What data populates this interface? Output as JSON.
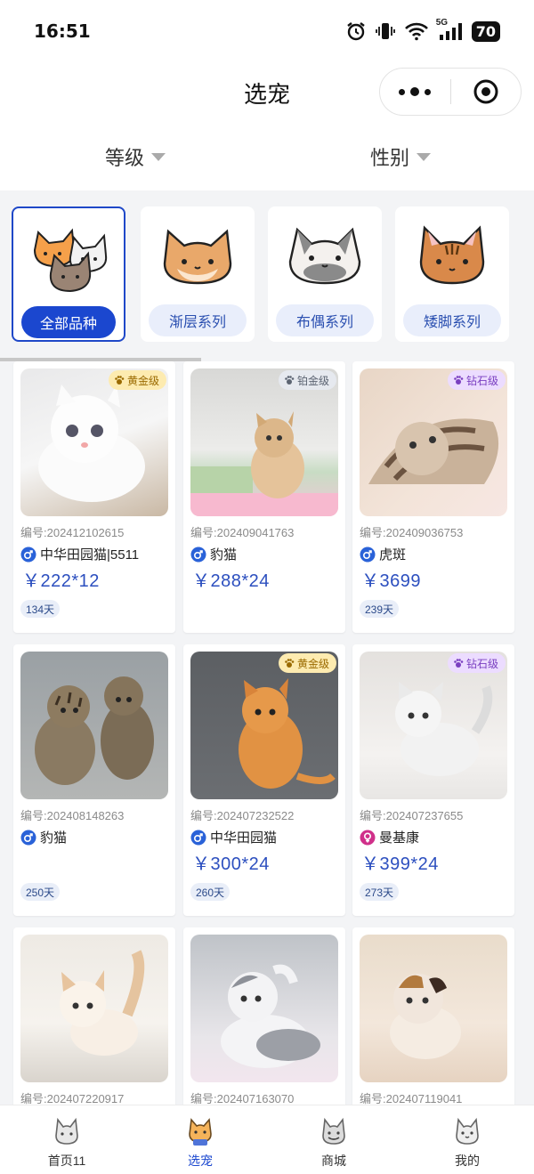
{
  "status_bar": {
    "time": "16:51",
    "network": "5G",
    "battery": "70"
  },
  "nav": {
    "title": "选宠"
  },
  "filters": {
    "level_label": "等级",
    "gender_label": "性别"
  },
  "categories": [
    {
      "label": "全部品种",
      "active": true
    },
    {
      "label": "渐层系列",
      "active": false
    },
    {
      "label": "布偶系列",
      "active": false
    },
    {
      "label": "矮脚系列",
      "active": false
    }
  ],
  "pets": [
    {
      "badge": "黄金级",
      "badge_type": "gold",
      "no": "编号:202412102615",
      "gender": "male",
      "breed": "中华田园猫|5511",
      "price": "￥222*12",
      "age": "134天"
    },
    {
      "badge": "铂金级",
      "badge_type": "platinum",
      "no": "编号:202409041763",
      "gender": "male",
      "breed": "豹猫",
      "price": "￥288*24",
      "age": ""
    },
    {
      "badge": "钻石级",
      "badge_type": "diamond",
      "no": "编号:202409036753",
      "gender": "male",
      "breed": "虎斑",
      "price": "￥3699",
      "age": "239天"
    },
    {
      "badge": "",
      "badge_type": "",
      "no": "编号:202408148263",
      "gender": "male",
      "breed": "豹猫",
      "price": "",
      "age": "250天"
    },
    {
      "badge": "黄金级",
      "badge_type": "gold",
      "no": "编号:202407232522",
      "gender": "male",
      "breed": "中华田园猫",
      "price": "￥300*24",
      "age": "260天"
    },
    {
      "badge": "钻石级",
      "badge_type": "diamond",
      "no": "编号:202407237655",
      "gender": "female",
      "breed": "曼基康",
      "price": "￥399*24",
      "age": "273天"
    },
    {
      "badge": "",
      "badge_type": "",
      "no": "编号:202407220917",
      "gender": "",
      "breed": "",
      "price": "",
      "age": ""
    },
    {
      "badge": "",
      "badge_type": "",
      "no": "编号:202407163070",
      "gender": "",
      "breed": "",
      "price": "",
      "age": ""
    },
    {
      "badge": "",
      "badge_type": "",
      "no": "编号:202407119041",
      "gender": "",
      "breed": "",
      "price": "",
      "age": ""
    }
  ],
  "tabs": [
    {
      "label": "首页11",
      "icon": "cat-home-icon",
      "active": false
    },
    {
      "label": "选宠",
      "icon": "cat-select-icon",
      "active": true
    },
    {
      "label": "商城",
      "icon": "cat-shop-icon",
      "active": false
    },
    {
      "label": "我的",
      "icon": "cat-profile-icon",
      "active": false
    }
  ],
  "colors": {
    "accent": "#1b47cf",
    "price": "#2c4fbf",
    "male": "#2a62d8",
    "female": "#d0308a"
  }
}
